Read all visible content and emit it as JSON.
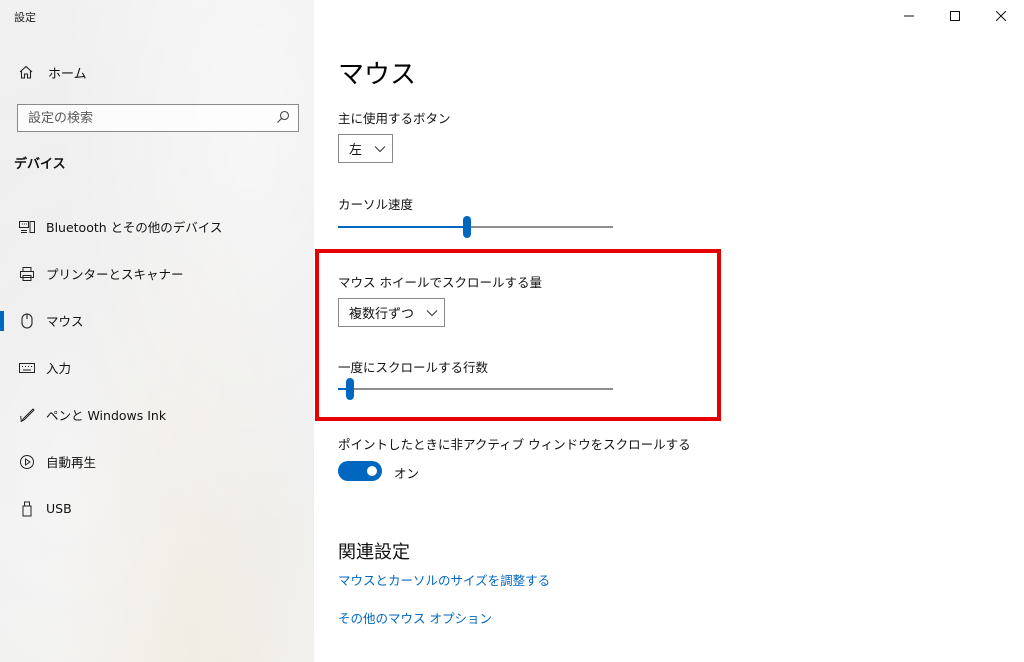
{
  "window": {
    "title": "設定"
  },
  "sidebar": {
    "home_label": "ホーム",
    "search_placeholder": "設定の検索",
    "section_title": "デバイス",
    "items": [
      {
        "label": "Bluetooth とその他のデバイス",
        "icon": "bluetooth-devices-icon",
        "active": false
      },
      {
        "label": "プリンターとスキャナー",
        "icon": "printer-icon",
        "active": false
      },
      {
        "label": "マウス",
        "icon": "mouse-icon",
        "active": true
      },
      {
        "label": "入力",
        "icon": "keyboard-icon",
        "active": false
      },
      {
        "label": "ペンと Windows Ink",
        "icon": "pen-icon",
        "active": false
      },
      {
        "label": "自動再生",
        "icon": "autoplay-icon",
        "active": false
      },
      {
        "label": "USB",
        "icon": "usb-icon",
        "active": false
      }
    ]
  },
  "main": {
    "title": "マウス",
    "primary_button": {
      "label": "主に使用するボタン",
      "value": "左"
    },
    "cursor_speed": {
      "label": "カーソル速度",
      "level": 0.47
    },
    "scroll_amount": {
      "label": "マウス ホイールでスクロールする量",
      "value": "複数行ずつ"
    },
    "scroll_lines": {
      "label": "一度にスクロールする行数",
      "level": 0.03
    },
    "inactive_scroll": {
      "label": "ポイントしたときに非アクティブ ウィンドウをスクロールする",
      "state_label": "オン",
      "on": true
    },
    "related": {
      "title": "関連設定",
      "links": [
        "マウスとカーソルのサイズを調整する",
        "その他のマウス オプション"
      ]
    }
  },
  "colors": {
    "accent": "#0067c0",
    "highlight": "#e60000"
  }
}
